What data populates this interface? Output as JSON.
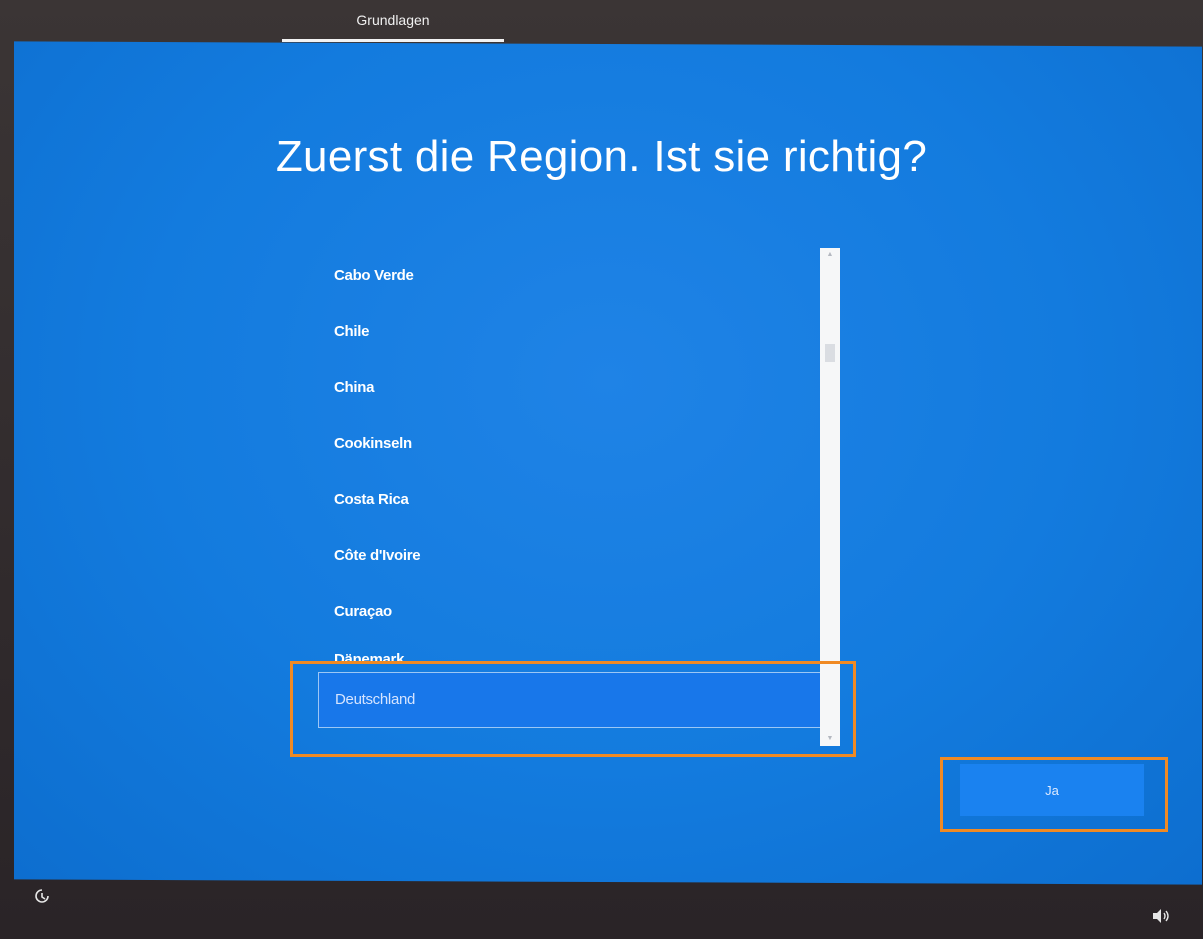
{
  "header": {
    "tab_label": "Grundlagen"
  },
  "main": {
    "title": "Zuerst die Region. Ist sie richtig?",
    "regions": [
      "Cabo Verde",
      "Chile",
      "China",
      "Cookinseln",
      "Costa Rica",
      "Côte d'Ivoire",
      "Curaçao",
      "Dänemark"
    ],
    "selected_region": "Deutschland",
    "confirm_label": "Ja"
  },
  "icons": {
    "accessibility": "accessibility-icon",
    "volume": "volume-icon"
  },
  "colors": {
    "background_blue": "#137bde",
    "button_blue": "#1a82f0",
    "highlight_orange": "#f08a24"
  }
}
